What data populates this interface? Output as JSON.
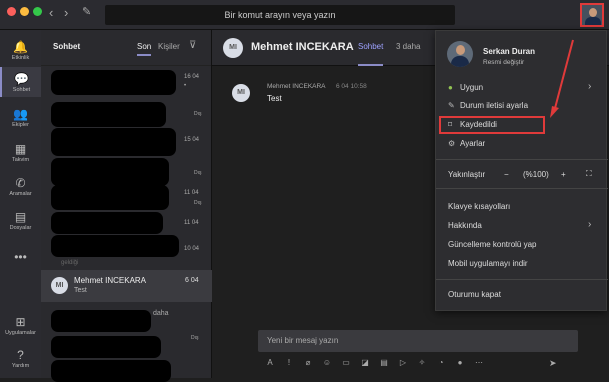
{
  "titlebar": {
    "search_placeholder": "Bir komut arayın veya yazın"
  },
  "rail": [
    {
      "label": "Etkinlik",
      "icon": "bell-icon",
      "glyph": "🔔",
      "active": false
    },
    {
      "label": "Sohbet",
      "icon": "chat-icon",
      "glyph": "💬",
      "active": true
    },
    {
      "label": "Ekipler",
      "icon": "teams-icon",
      "glyph": "👥",
      "active": false
    },
    {
      "label": "Takvim",
      "icon": "calendar-icon",
      "glyph": "▦",
      "active": false
    },
    {
      "label": "Aramalar",
      "icon": "phone-icon",
      "glyph": "✆",
      "active": false
    },
    {
      "label": "Dosyalar",
      "icon": "files-icon",
      "glyph": "▤",
      "active": false
    },
    {
      "label": "",
      "icon": "more-icon",
      "glyph": "•••",
      "active": false
    }
  ],
  "rail_bottom": [
    {
      "label": "Uygulamalar",
      "icon": "apps-icon",
      "glyph": "⊞"
    },
    {
      "label": "Yardım",
      "icon": "help-icon",
      "glyph": "?"
    }
  ],
  "chatlist": {
    "title": "Sohbet",
    "tab_recent": "Son",
    "tab_contacts": "Kişiler",
    "meta": [
      "16 04",
      "•",
      "Dış",
      "15 04",
      "Dış",
      "11 04",
      "Dış",
      "11 04",
      "10 04",
      "Dış"
    ],
    "partial_text": "geldiği",
    "partial_text2": "daha",
    "selected": {
      "initials": "MI",
      "name": "Mehmet INCEKARA",
      "preview": "Test",
      "date": "6 04"
    }
  },
  "conversation": {
    "initials": "MI",
    "name": "Mehmet INCEKARA",
    "tab": "Sohbet",
    "more": "3 daha",
    "message": {
      "sender": "Mehmet INCEKARA",
      "time": "6 04 10:58",
      "text": "Test"
    },
    "compose_placeholder": "Yeni bir mesaj yazın"
  },
  "profile_menu": {
    "name": "Serkan Duran",
    "change_picture": "Resmi değiştir",
    "status": "Uygun",
    "status_message": "Durum iletisi ayarla",
    "saved": "Kaydedildi",
    "settings": "Ayarlar",
    "zoom_label": "Yakınlaştır",
    "zoom_minus": "−",
    "zoom_value": "(%100)",
    "zoom_plus": "+",
    "shortcuts": "Klavye kısayolları",
    "about": "Hakkında",
    "check_updates": "Güncelleme kontrolü yap",
    "mobile": "Mobil uygulamayı indir",
    "signout": "Oturumu kapat"
  },
  "colors": {
    "accent": "#8b8cc7",
    "highlight": "#e03a3a",
    "status_green": "#92c353"
  }
}
